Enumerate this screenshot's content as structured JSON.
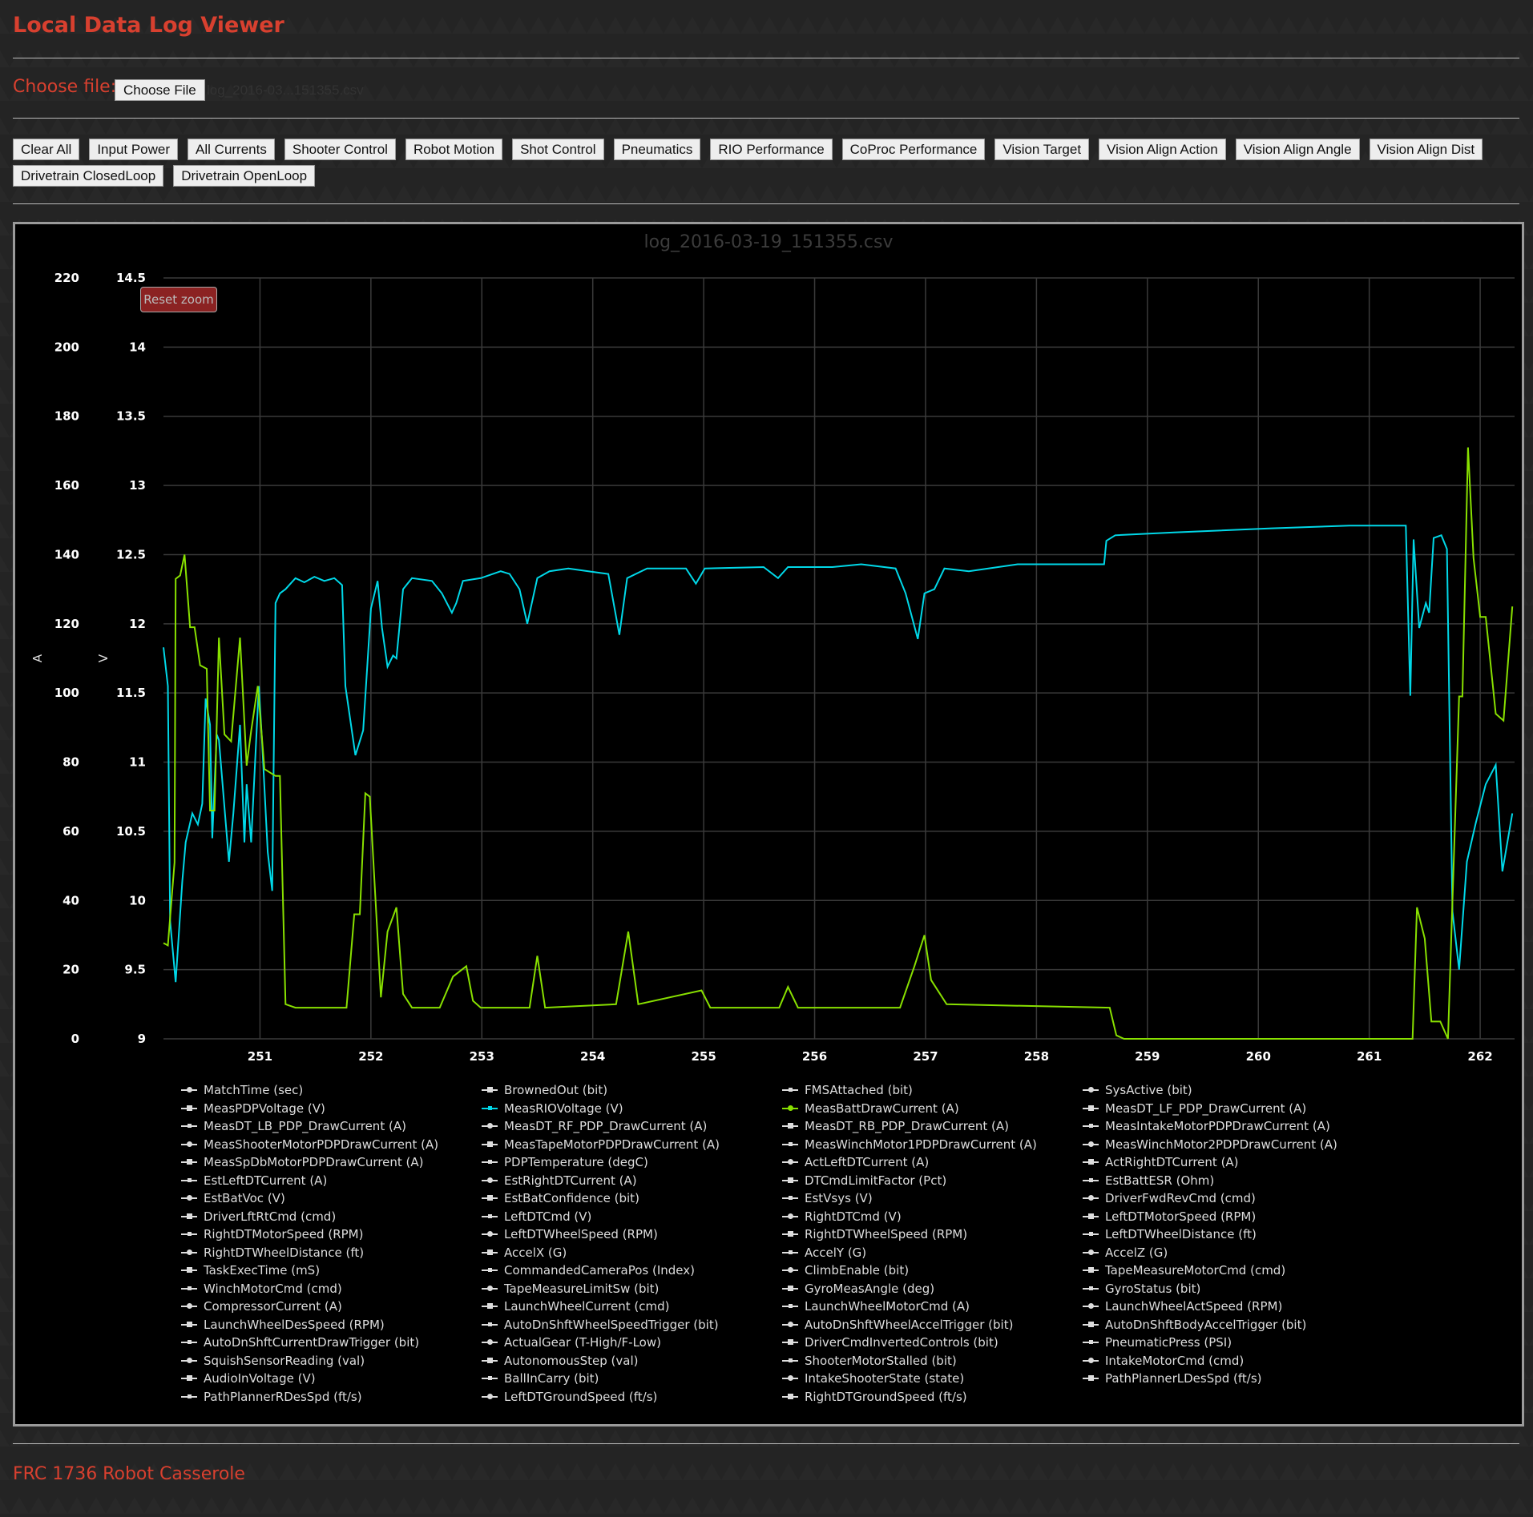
{
  "header": {
    "title": "Local Data Log Viewer"
  },
  "file": {
    "label": "Choose file:",
    "button": "Choose File",
    "selected": "log_2016-03...151355.csv"
  },
  "presets": [
    "Clear All",
    "Input Power",
    "All Currents",
    "Shooter Control",
    "Robot Motion",
    "Shot Control",
    "Pneumatics",
    "RIO Performance",
    "CoProc Performance",
    "Vision Target",
    "Vision Align Action",
    "Vision Align Angle",
    "Vision Align Dist",
    "Drivetrain ClosedLoop",
    "Drivetrain OpenLoop"
  ],
  "footer": "FRC 1736 Robot Casserole",
  "chart_data": {
    "type": "line",
    "title": "log_2016-03-19_151355.csv",
    "reset_zoom": "Reset zoom",
    "grid": true,
    "xlim": [
      250.13,
      262.31
    ],
    "xticks": [
      251,
      252,
      253,
      254,
      255,
      256,
      257,
      258,
      259,
      260,
      261,
      262
    ],
    "y_left": {
      "label": "A",
      "lim": [
        0,
        220
      ],
      "ticks": [
        0,
        20,
        40,
        60,
        80,
        100,
        120,
        140,
        160,
        180,
        200,
        220
      ]
    },
    "y_right": {
      "label": "V",
      "lim": [
        9,
        14.5
      ],
      "ticks": [
        "9",
        "9.5",
        "10",
        "10.5",
        "11",
        "11.5",
        "12",
        "12.5",
        "13",
        "13.5",
        "14",
        "14.5"
      ]
    },
    "legend_placement": "bottom",
    "colors": {
      "inactive": "#dddddd",
      "rio_voltage": "#00d8e8",
      "batt_current": "#88e000"
    },
    "series": [
      {
        "name": "MeasRIOVoltage (V)",
        "axis": "right",
        "color": "#00d8e8",
        "points": [
          [
            250.13,
            11.83
          ],
          [
            250.17,
            11.55
          ],
          [
            250.19,
            9.85
          ],
          [
            250.24,
            9.41
          ],
          [
            250.3,
            10.14
          ],
          [
            250.33,
            10.42
          ],
          [
            250.39,
            10.63
          ],
          [
            250.44,
            10.55
          ],
          [
            250.48,
            10.7
          ],
          [
            250.51,
            11.46
          ],
          [
            250.55,
            11.27
          ],
          [
            250.57,
            10.45
          ],
          [
            250.61,
            11.2
          ],
          [
            250.63,
            11.16
          ],
          [
            250.72,
            10.28
          ],
          [
            250.76,
            10.63
          ],
          [
            250.82,
            11.27
          ],
          [
            250.86,
            10.42
          ],
          [
            250.88,
            10.84
          ],
          [
            250.92,
            10.42
          ],
          [
            250.99,
            11.55
          ],
          [
            251.02,
            11.13
          ],
          [
            251.07,
            10.35
          ],
          [
            251.11,
            10.07
          ],
          [
            251.14,
            12.15
          ],
          [
            251.18,
            12.22
          ],
          [
            251.23,
            12.25
          ],
          [
            251.32,
            12.33
          ],
          [
            251.4,
            12.3
          ],
          [
            251.49,
            12.34
          ],
          [
            251.58,
            12.31
          ],
          [
            251.67,
            12.33
          ],
          [
            251.74,
            12.28
          ],
          [
            251.77,
            11.55
          ],
          [
            251.86,
            11.05
          ],
          [
            251.93,
            11.23
          ],
          [
            252.0,
            12.11
          ],
          [
            252.06,
            12.31
          ],
          [
            252.1,
            11.97
          ],
          [
            252.15,
            11.69
          ],
          [
            252.2,
            11.77
          ],
          [
            252.23,
            11.75
          ],
          [
            252.29,
            12.25
          ],
          [
            252.37,
            12.33
          ],
          [
            252.55,
            12.31
          ],
          [
            252.64,
            12.22
          ],
          [
            252.73,
            12.08
          ],
          [
            252.77,
            12.15
          ],
          [
            252.83,
            12.31
          ],
          [
            252.99,
            12.33
          ],
          [
            253.17,
            12.38
          ],
          [
            253.25,
            12.36
          ],
          [
            253.34,
            12.25
          ],
          [
            253.41,
            12.0
          ],
          [
            253.5,
            12.33
          ],
          [
            253.61,
            12.38
          ],
          [
            253.78,
            12.4
          ],
          [
            253.96,
            12.38
          ],
          [
            254.14,
            12.36
          ],
          [
            254.24,
            11.92
          ],
          [
            254.31,
            12.33
          ],
          [
            254.49,
            12.4
          ],
          [
            254.84,
            12.4
          ],
          [
            254.93,
            12.29
          ],
          [
            255.01,
            12.4
          ],
          [
            255.54,
            12.41
          ],
          [
            255.67,
            12.33
          ],
          [
            255.76,
            12.41
          ],
          [
            256.16,
            12.41
          ],
          [
            256.42,
            12.43
          ],
          [
            256.73,
            12.4
          ],
          [
            256.82,
            12.22
          ],
          [
            256.93,
            11.89
          ],
          [
            256.99,
            12.22
          ],
          [
            257.08,
            12.25
          ],
          [
            257.17,
            12.4
          ],
          [
            257.39,
            12.38
          ],
          [
            257.83,
            12.43
          ],
          [
            258.18,
            12.43
          ],
          [
            258.61,
            12.43
          ],
          [
            258.63,
            12.6
          ],
          [
            258.71,
            12.64
          ],
          [
            259.24,
            12.66
          ],
          [
            260.12,
            12.69
          ],
          [
            260.82,
            12.71
          ],
          [
            261.33,
            12.71
          ],
          [
            261.37,
            11.48
          ],
          [
            261.4,
            12.61
          ],
          [
            261.45,
            11.97
          ],
          [
            261.51,
            12.15
          ],
          [
            261.54,
            12.08
          ],
          [
            261.58,
            12.62
          ],
          [
            261.65,
            12.64
          ],
          [
            261.7,
            12.54
          ],
          [
            261.75,
            9.92
          ],
          [
            261.81,
            9.5
          ],
          [
            261.88,
            10.28
          ],
          [
            261.96,
            10.56
          ],
          [
            262.05,
            10.84
          ],
          [
            262.14,
            10.98
          ],
          [
            262.2,
            10.21
          ],
          [
            262.29,
            10.63
          ]
        ]
      },
      {
        "name": "MeasBattDrawCurrent (A)",
        "axis": "left",
        "color": "#88e000",
        "points": [
          [
            250.13,
            27.7
          ],
          [
            250.17,
            27
          ],
          [
            250.23,
            51
          ],
          [
            250.24,
            133
          ],
          [
            250.28,
            134
          ],
          [
            250.32,
            140
          ],
          [
            250.37,
            119
          ],
          [
            250.41,
            119
          ],
          [
            250.46,
            108
          ],
          [
            250.52,
            107
          ],
          [
            250.55,
            66
          ],
          [
            250.59,
            66
          ],
          [
            250.63,
            116
          ],
          [
            250.68,
            88
          ],
          [
            250.74,
            86
          ],
          [
            250.82,
            116
          ],
          [
            250.88,
            79
          ],
          [
            250.92,
            89
          ],
          [
            250.98,
            102
          ],
          [
            251.04,
            78
          ],
          [
            251.14,
            76
          ],
          [
            251.18,
            76
          ],
          [
            251.23,
            10
          ],
          [
            251.32,
            9
          ],
          [
            251.78,
            9
          ],
          [
            251.85,
            36
          ],
          [
            251.9,
            36
          ],
          [
            251.95,
            71
          ],
          [
            251.99,
            70
          ],
          [
            252.09,
            12
          ],
          [
            252.15,
            31
          ],
          [
            252.23,
            38
          ],
          [
            252.29,
            13
          ],
          [
            252.37,
            9
          ],
          [
            252.62,
            9
          ],
          [
            252.74,
            18
          ],
          [
            252.86,
            21
          ],
          [
            252.92,
            11
          ],
          [
            252.99,
            9
          ],
          [
            253.43,
            9
          ],
          [
            253.5,
            24
          ],
          [
            253.57,
            9
          ],
          [
            254.21,
            10
          ],
          [
            254.32,
            31
          ],
          [
            254.41,
            10
          ],
          [
            254.98,
            14
          ],
          [
            255.06,
            9
          ],
          [
            255.68,
            9
          ],
          [
            255.76,
            15
          ],
          [
            255.85,
            9
          ],
          [
            256.77,
            9
          ],
          [
            256.9,
            21
          ],
          [
            256.99,
            30
          ],
          [
            257.05,
            17
          ],
          [
            257.19,
            10
          ],
          [
            258.66,
            9
          ],
          [
            258.72,
            1
          ],
          [
            258.79,
            0
          ],
          [
            261.39,
            0
          ],
          [
            261.43,
            38
          ],
          [
            261.5,
            29
          ],
          [
            261.56,
            5
          ],
          [
            261.64,
            5
          ],
          [
            261.71,
            0
          ],
          [
            261.81,
            99
          ],
          [
            261.84,
            99
          ],
          [
            261.89,
            171
          ],
          [
            261.94,
            139
          ],
          [
            262.0,
            122
          ],
          [
            262.05,
            122
          ],
          [
            262.14,
            94
          ],
          [
            262.21,
            92
          ],
          [
            262.29,
            125
          ]
        ]
      }
    ],
    "legend": [
      {
        "label": "MatchTime (sec)"
      },
      {
        "label": "BrownedOut (bit)"
      },
      {
        "label": "FMSAttached (bit)"
      },
      {
        "label": "SysActive (bit)"
      },
      {
        "label": "MeasPDPVoltage (V)"
      },
      {
        "label": "MeasRIOVoltage (V)",
        "color": "#00d8e8"
      },
      {
        "label": "MeasBattDrawCurrent (A)",
        "color": "#88e000"
      },
      {
        "label": "MeasDT_LF_PDP_DrawCurrent (A)"
      },
      {
        "label": "MeasDT_LB_PDP_DrawCurrent (A)"
      },
      {
        "label": "MeasDT_RF_PDP_DrawCurrent (A)"
      },
      {
        "label": "MeasDT_RB_PDP_DrawCurrent (A)"
      },
      {
        "label": "MeasIntakeMotorPDPDrawCurrent (A)"
      },
      {
        "label": "MeasShooterMotorPDPDrawCurrent (A)"
      },
      {
        "label": "MeasTapeMotorPDPDrawCurrent (A)"
      },
      {
        "label": "MeasWinchMotor1PDPDrawCurrent (A)"
      },
      {
        "label": "MeasWinchMotor2PDPDrawCurrent (A)"
      },
      {
        "label": "MeasSpDbMotorPDPDrawCurrent (A)"
      },
      {
        "label": "PDPTemperature (degC)"
      },
      {
        "label": "ActLeftDTCurrent (A)"
      },
      {
        "label": "ActRightDTCurrent (A)"
      },
      {
        "label": "EstLeftDTCurrent (A)"
      },
      {
        "label": "EstRightDTCurrent (A)"
      },
      {
        "label": "DTCmdLimitFactor (Pct)"
      },
      {
        "label": "EstBattESR (Ohm)"
      },
      {
        "label": "EstBatVoc (V)"
      },
      {
        "label": "EstBatConfidence (bit)"
      },
      {
        "label": "EstVsys (V)"
      },
      {
        "label": "DriverFwdRevCmd (cmd)"
      },
      {
        "label": "DriverLftRtCmd (cmd)"
      },
      {
        "label": "LeftDTCmd (V)"
      },
      {
        "label": "RightDTCmd (V)"
      },
      {
        "label": "LeftDTMotorSpeed (RPM)"
      },
      {
        "label": "RightDTMotorSpeed (RPM)"
      },
      {
        "label": "LeftDTWheelSpeed (RPM)"
      },
      {
        "label": "RightDTWheelSpeed (RPM)"
      },
      {
        "label": "LeftDTWheelDistance (ft)"
      },
      {
        "label": "RightDTWheelDistance (ft)"
      },
      {
        "label": "AccelX (G)"
      },
      {
        "label": "AccelY (G)"
      },
      {
        "label": "AccelZ (G)"
      },
      {
        "label": "TaskExecTime (mS)"
      },
      {
        "label": "CommandedCameraPos (Index)"
      },
      {
        "label": "ClimbEnable (bit)"
      },
      {
        "label": "TapeMeasureMotorCmd (cmd)"
      },
      {
        "label": "WinchMotorCmd (cmd)"
      },
      {
        "label": "TapeMeasureLimitSw (bit)"
      },
      {
        "label": "GyroMeasAngle (deg)"
      },
      {
        "label": "GyroStatus (bit)"
      },
      {
        "label": "CompressorCurrent (A)"
      },
      {
        "label": "LaunchWheelCurrent (cmd)"
      },
      {
        "label": "LaunchWheelMotorCmd (A)"
      },
      {
        "label": "LaunchWheelActSpeed (RPM)"
      },
      {
        "label": "LaunchWheelDesSpeed (RPM)"
      },
      {
        "label": "AutoDnShftWheelSpeedTrigger (bit)"
      },
      {
        "label": "AutoDnShftWheelAccelTrigger (bit)"
      },
      {
        "label": "AutoDnShftBodyAccelTrigger (bit)"
      },
      {
        "label": "AutoDnShftCurrentDrawTrigger (bit)"
      },
      {
        "label": "ActualGear (T-High/F-Low)"
      },
      {
        "label": "DriverCmdInvertedControls (bit)"
      },
      {
        "label": "PneumaticPress (PSI)"
      },
      {
        "label": "SquishSensorReading (val)"
      },
      {
        "label": "AutonomousStep (val)"
      },
      {
        "label": "ShooterMotorStalled (bit)"
      },
      {
        "label": "IntakeMotorCmd (cmd)"
      },
      {
        "label": "AudioInVoltage (V)"
      },
      {
        "label": "BallInCarry (bit)"
      },
      {
        "label": "IntakeShooterState (state)"
      },
      {
        "label": "PathPlannerLDesSpd (ft/s)"
      },
      {
        "label": "PathPlannerRDesSpd (ft/s)"
      },
      {
        "label": "LeftDTGroundSpeed (ft/s)"
      },
      {
        "label": "RightDTGroundSpeed (ft/s)"
      }
    ]
  }
}
